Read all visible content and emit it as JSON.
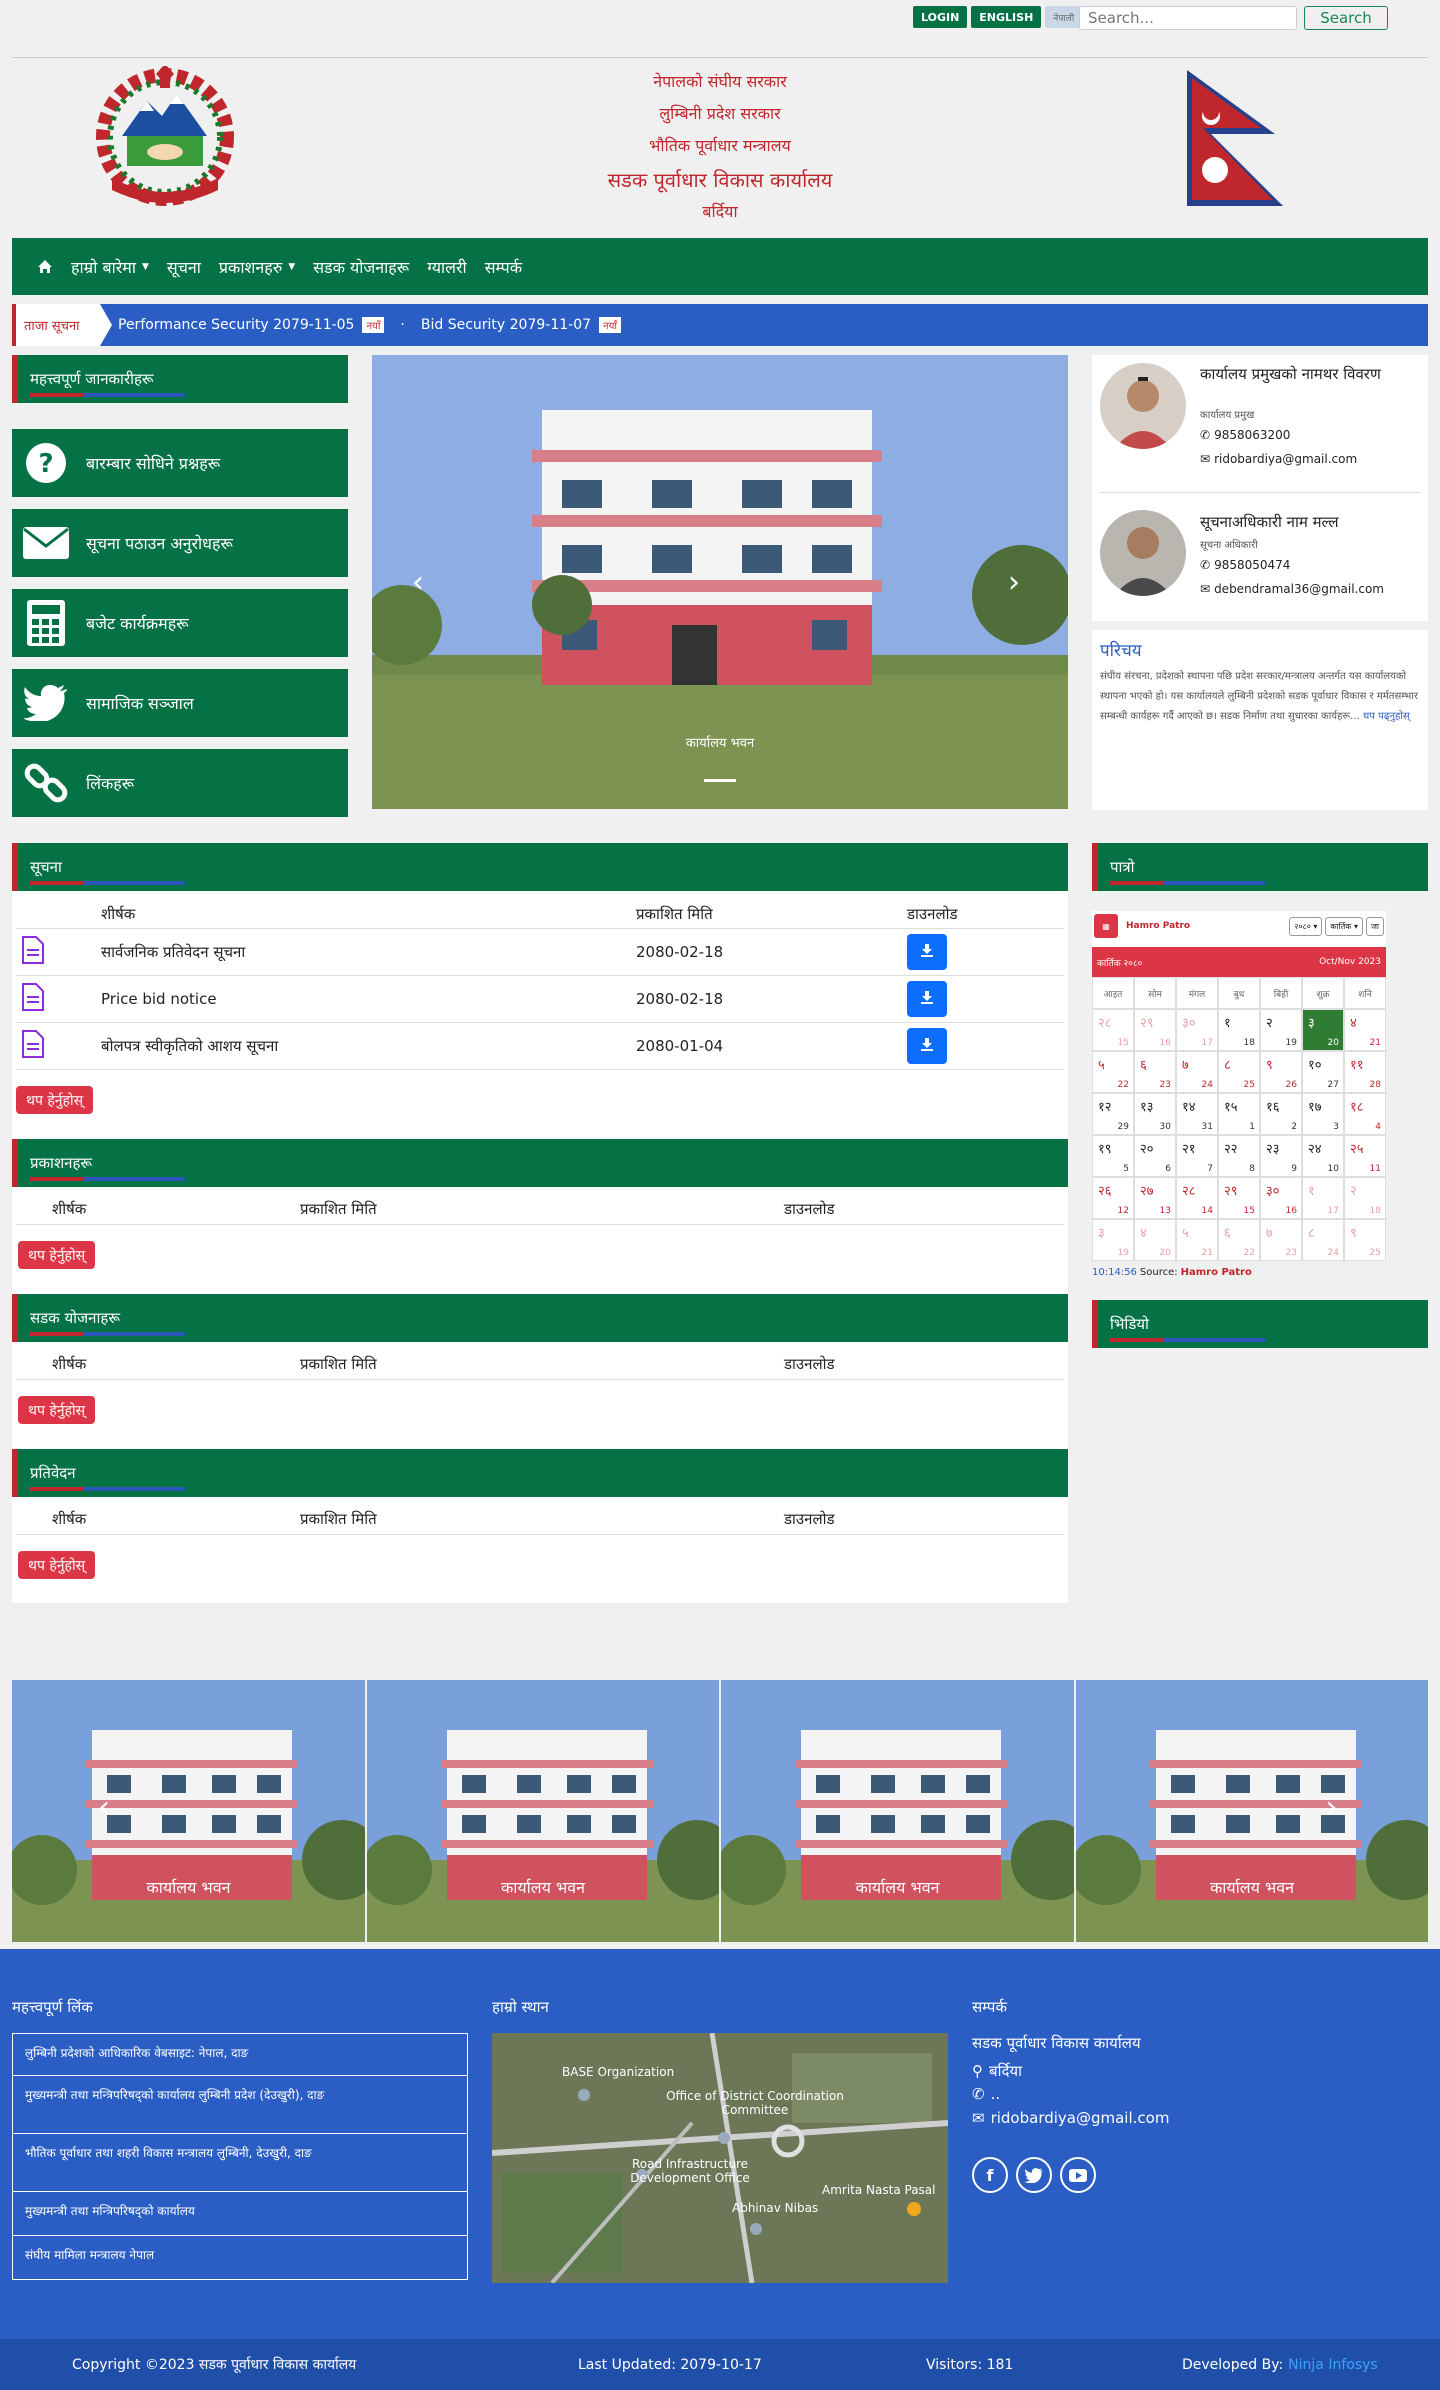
{
  "topbar": {
    "login": "LOGIN",
    "english": "ENGLISH",
    "nepali": "नेपाली",
    "search_placeholder": "Search...",
    "search_button": "Search"
  },
  "header": {
    "line1": "नेपालको संघीय सरकार",
    "line2": "लुम्बिनी प्रदेश सरकार",
    "line3": "भौतिक पूर्वाधार मन्त्रालय",
    "line4": "सडक पूर्वाधार विकास कार्यालय",
    "line5": "बर्दिया",
    "emblem_text": "सडक पूर्वाधार विकास कार्यालय"
  },
  "nav": [
    "हाम्रो बारेमा",
    "सूचना",
    "प्रकाशनहरु",
    "सडक योजनाहरू",
    "ग्यालरी",
    "सम्पर्क"
  ],
  "ticker": {
    "label": "ताजा सूचना",
    "items": [
      {
        "text": "Performance Security 2079-11-05",
        "badge": "नयाँ"
      },
      {
        "text": "Bid Security 2079-11-07",
        "badge": "नयाँ"
      }
    ],
    "separator": "·"
  },
  "sidebar": {
    "title": "महत्त्वपूर्ण जानकारीहरू",
    "items": [
      {
        "icon": "question-icon",
        "label": "बारम्बार सोधिने प्रश्नहरू"
      },
      {
        "icon": "envelope-icon",
        "label": "सूचना पठाउन अनुरोधहरू"
      },
      {
        "icon": "calculator-icon",
        "label": "बजेट कार्यक्रमहरू"
      },
      {
        "icon": "twitter-icon",
        "label": "सामाजिक सञ्जाल"
      },
      {
        "icon": "link-icon",
        "label": "लिंकहरू"
      }
    ]
  },
  "slider": {
    "caption": "कार्यालय भवन"
  },
  "staff": [
    {
      "name": "कार्यालय प्रमुखको नामथर विवरण",
      "role": "कार्यालय प्रमुख",
      "phone": "9858063200",
      "email": "ridobardiya@gmail.com"
    },
    {
      "name": "सूचनाअधिकारी नाम मल्ल",
      "role": "सूचना अधिकारी",
      "phone": "9858050474",
      "email": "debendramal36@gmail.com"
    }
  ],
  "about": {
    "title": "परिचय",
    "text": "संघीय संरचना, प्रदेशको स्थापना पछि प्रदेश सरकार/मन्त्रालय अन्तर्गत यस कार्यालयको स्थापना भएको हो। यस कार्यालयले लुम्बिनी प्रदेशको सडक पूर्वाधार विकास र मर्मतसम्भार सम्बन्धी कार्यहरू गर्दै आएको छ। सडक निर्माण तथा सुधारका कार्यहरू...",
    "more": "थप पढ्नुहोस्"
  },
  "notices": {
    "title": "सूचना",
    "headers": [
      "शीर्षक",
      "प्रकाशित मिति",
      "डाउनलोड"
    ],
    "rows": [
      {
        "title": "सार्वजनिक प्रतिवेदन सूचना",
        "date": "2080-02-18"
      },
      {
        "title": "Price bid notice",
        "date": "2080-02-18"
      },
      {
        "title": "बोलपत्र स्वीकृतिको आशय सूचना",
        "date": "2080-01-04"
      }
    ],
    "more": "थप हेर्नुहोस्"
  },
  "publications": {
    "title": "प्रकाशनहरू",
    "headers": [
      "शीर्षक",
      "प्रकाशित मिति",
      "डाउनलोड"
    ],
    "more": "थप हेर्नुहोस्"
  },
  "road_plans": {
    "title": "सडक योजनाहरू",
    "headers": [
      "शीर्षक",
      "प्रकाशित मिति",
      "डाउनलोड"
    ],
    "more": "थप हेर्नुहोस्"
  },
  "reports": {
    "title": "प्रतिवेदन",
    "headers": [
      "शीर्षक",
      "प्रकाशित मिति",
      "डाउनलोड"
    ],
    "more": "थप हेर्नुहोस्"
  },
  "calendar": {
    "title": "पात्रो",
    "brand": "Hamro Patro",
    "year_select": "२०८०",
    "month_select": "कार्तिक",
    "go": "जा",
    "month_label": "कार्तिक २०८०",
    "eng_label": "Oct/Nov 2023",
    "weekdays": [
      "आइत",
      "सोम",
      "मंगल",
      "बुध",
      "बिही",
      "शुक्र",
      "शनि"
    ],
    "weeks": [
      [
        [
          "२८",
          "15",
          1
        ],
        [
          "२९",
          "16",
          1
        ],
        [
          "३०",
          "17",
          1
        ],
        [
          "१",
          "18",
          0
        ],
        [
          "२",
          "19",
          0
        ],
        [
          "३",
          "20",
          2
        ],
        [
          "४",
          "21",
          0
        ]
      ],
      [
        [
          "५",
          "22",
          0
        ],
        [
          "६",
          "23",
          0
        ],
        [
          "७",
          "24",
          0
        ],
        [
          "८",
          "25",
          0
        ],
        [
          "९",
          "26",
          0
        ],
        [
          "१०",
          "27",
          0
        ],
        [
          "११",
          "28",
          0
        ]
      ],
      [
        [
          "१२",
          "29",
          0
        ],
        [
          "१३",
          "30",
          0
        ],
        [
          "१४",
          "31",
          0
        ],
        [
          "१५",
          "1",
          0
        ],
        [
          "१६",
          "2",
          0
        ],
        [
          "१७",
          "3",
          0
        ],
        [
          "१८",
          "4",
          0
        ]
      ],
      [
        [
          "१९",
          "5",
          0
        ],
        [
          "२०",
          "6",
          0
        ],
        [
          "२१",
          "7",
          0
        ],
        [
          "२२",
          "8",
          0
        ],
        [
          "२३",
          "9",
          0
        ],
        [
          "२४",
          "10",
          0
        ],
        [
          "२५",
          "11",
          0
        ]
      ],
      [
        [
          "२६",
          "12",
          0
        ],
        [
          "२७",
          "13",
          0
        ],
        [
          "२८",
          "14",
          0
        ],
        [
          "२९",
          "15",
          0
        ],
        [
          "३०",
          "16",
          0
        ],
        [
          "१",
          "17",
          1
        ],
        [
          "२",
          "18",
          1
        ]
      ],
      [
        [
          "३",
          "19",
          1
        ],
        [
          "४",
          "20",
          1
        ],
        [
          "५",
          "21",
          1
        ],
        [
          "६",
          "22",
          1
        ],
        [
          "७",
          "23",
          1
        ],
        [
          "८",
          "24",
          1
        ],
        [
          "९",
          "25",
          1
        ]
      ]
    ],
    "time": "10:14:56",
    "source_label": "Source:",
    "source": "Hamro Patro"
  },
  "video": {
    "title": "भिडियो"
  },
  "gallery": {
    "caption": "कार्यालय भवन"
  },
  "footer": {
    "links_title": "महत्त्वपूर्ण लिंक",
    "links": [
      "लुम्बिनी प्रदेशको आधिकारिक वेबसाइट: नेपाल, दाङ",
      "मुख्यमन्त्री तथा मन्त्रिपरिषद्को कार्यालय लुम्बिनी प्रदेश (देउखुरी), दाङ",
      "भौतिक पूर्वाधार तथा शहरी विकास मन्त्रालय लुम्बिनी, देउखुरी, दाङ",
      "मुख्यमन्त्री तथा मन्त्रिपरिषद्को कार्यालय",
      "संघीय मामिला मन्त्रालय नेपाल"
    ],
    "map_title": "हाम्रो स्थान",
    "map_labels": [
      "BASE Organization",
      "Office of District Coordination Committee",
      "Road Infrastructure Development Office",
      "Amrita Nasta Pasal",
      "Abhinav Nibas"
    ],
    "contact_title": "सम्पर्क",
    "office": "सडक पूर्वाधार विकास कार्यालय",
    "location": "बर्दिया",
    "phone": "..",
    "email": "ridobardiya@gmail.com"
  },
  "bottom": {
    "copyright": "Copyright ©2023 सडक पूर्वाधार विकास कार्यालय",
    "updated": "Last Updated: 2079-10-17",
    "visitors": "Visitors: 181",
    "dev_label": "Developed By:",
    "dev": "Ninja Infosys"
  },
  "colors": {
    "green": "#047245",
    "red": "#c0272d",
    "blue": "#2a5ec4",
    "footer": "#2a5ec4",
    "bottom": "#1f4fa8"
  }
}
